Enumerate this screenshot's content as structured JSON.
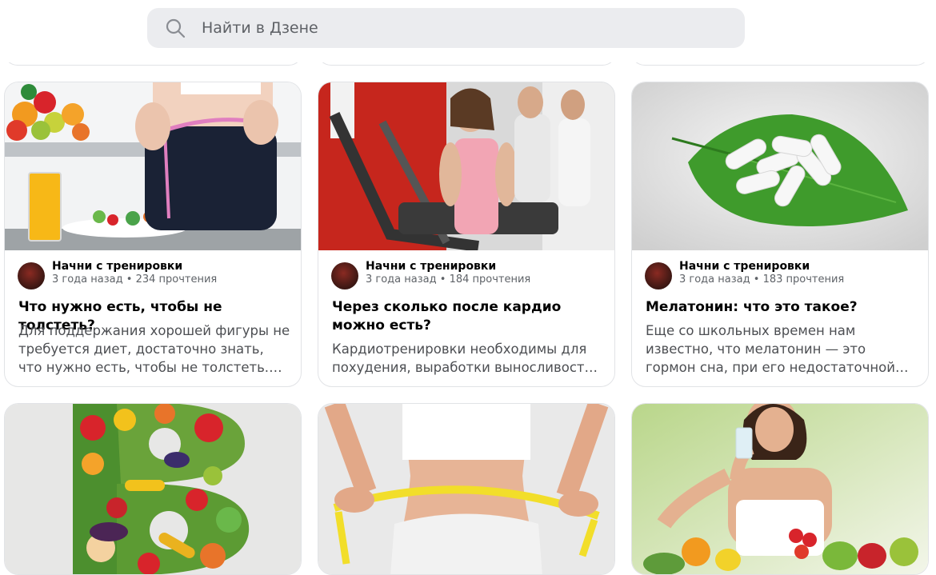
{
  "search": {
    "placeholder": "Найти в Дзене",
    "icon": "search-icon"
  },
  "cards": [
    {
      "channel": "Начни с тренировки",
      "age": "3 года назад",
      "reads": "234 прочтения",
      "title": "Что нужно есть, чтобы не толстеть?",
      "description": "Для поддержания хорошей фигуры не требуется диет, достаточно знать, что нужно есть, чтобы не толстеть. Правильное питание"
    },
    {
      "channel": "Начни с тренировки",
      "age": "3 года назад",
      "reads": "184 прочтения",
      "title": "Через сколько после кардио можно есть?",
      "description": "Кардиотренировки необходимы для похудения, выработки выносливости и укрепления сердечно-сосудистой системы"
    },
    {
      "channel": "Начни с тренировки",
      "age": "3 года назад",
      "reads": "183 прочтения",
      "title": "Мелатонин: что это такое?",
      "description": "Еще со школьных времен нам известно, что мелатонин — это гормон сна, при его недостаточной выработке"
    }
  ],
  "separator": "•"
}
